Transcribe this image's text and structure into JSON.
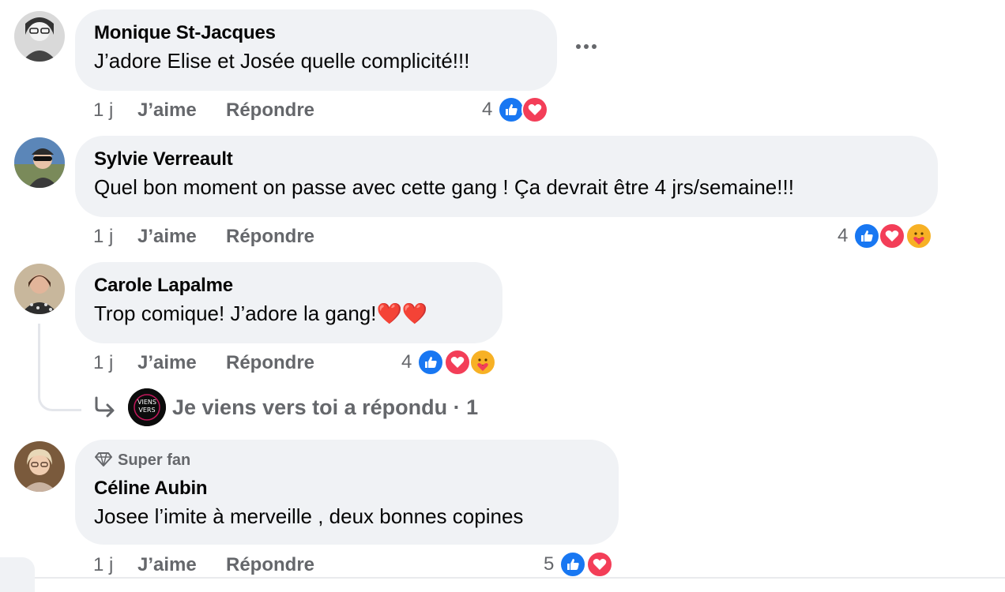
{
  "comments": [
    {
      "author": "Monique St-Jacques",
      "text": "J’adore Elise et Josée quelle complicité!!!",
      "time": "1 j",
      "like_label": "J’aime",
      "reply_label": "Répondre",
      "reaction_count": "4",
      "reactions": [
        "like",
        "love"
      ]
    },
    {
      "author": "Sylvie Verreault",
      "text": "Quel bon moment on passe avec cette gang ! Ça devrait être 4 jrs/semaine!!!",
      "time": "1 j",
      "like_label": "J’aime",
      "reply_label": "Répondre",
      "reaction_count": "4",
      "reactions": [
        "like",
        "love",
        "care"
      ]
    },
    {
      "author": "Carole Lapalme",
      "text": "Trop comique! J’adore la gang!❤️❤️",
      "time": "1 j",
      "like_label": "J’aime",
      "reply_label": "Répondre",
      "reaction_count": "4",
      "reactions": [
        "like",
        "love",
        "care"
      ],
      "replies_summary": "Je viens vers toi a répondu · 1"
    },
    {
      "badge": "Super fan",
      "author": "Céline Aubin",
      "text": "Josee l’imite à merveille , deux bonnes copines",
      "time": "1 j",
      "like_label": "J’aime",
      "reply_label": "Répondre",
      "reaction_count": "5",
      "reactions": [
        "like",
        "love"
      ]
    }
  ],
  "colors": {
    "bubble": "#f0f2f5",
    "meta_text": "#65676b",
    "like": "#1877f2",
    "love": "#f33e58",
    "care": "#f7b125"
  }
}
